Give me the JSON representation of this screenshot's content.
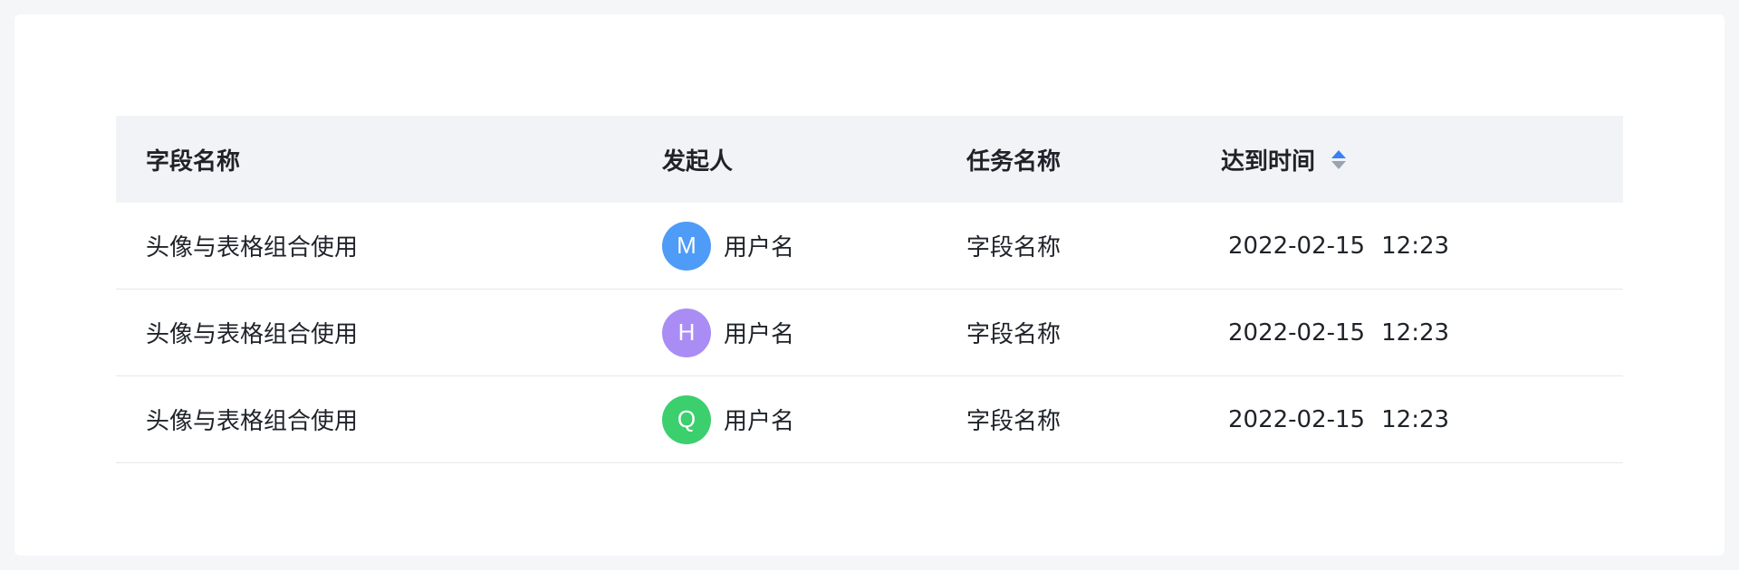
{
  "table": {
    "headers": {
      "field_name": "字段名称",
      "initiator": "发起人",
      "task_name": "任务名称",
      "arrival_time": "达到时间"
    },
    "sort_icon": "sort-caret-icon",
    "rows": [
      {
        "field_name": "头像与表格组合使用",
        "avatar_letter": "M",
        "avatar_color": "#4e9cf7",
        "initiator": "用户名",
        "task_name": "字段名称",
        "date": "2022-02-15",
        "time": "12:23"
      },
      {
        "field_name": "头像与表格组合使用",
        "avatar_letter": "H",
        "avatar_color": "#a98df5",
        "initiator": "用户名",
        "task_name": "字段名称",
        "date": "2022-02-15",
        "time": "12:23"
      },
      {
        "field_name": "头像与表格组合使用",
        "avatar_letter": "Q",
        "avatar_color": "#3ccf6e",
        "initiator": "用户名",
        "task_name": "字段名称",
        "date": "2022-02-15",
        "time": "12:23"
      }
    ]
  },
  "colors": {
    "header_bg": "#f2f3f6",
    "sort_active": "#3d7ff5",
    "sort_inactive": "#9aa3b2"
  }
}
